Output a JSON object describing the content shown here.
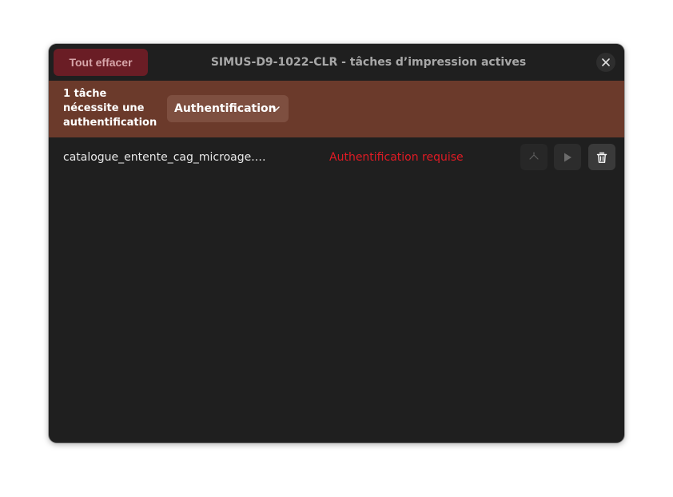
{
  "window": {
    "title": "SIMUS-D9-1022-CLR - tâches d’impression actives",
    "clear_all_label": "Tout effacer"
  },
  "banner": {
    "line1": "1 tâche",
    "line2": "nécessite une",
    "line3": "authentification",
    "auth_button_label": "Authentification"
  },
  "jobs": [
    {
      "name": "catalogue_entente_cag_microage.…",
      "status": "Authentification requise"
    }
  ],
  "colors": {
    "window_bg": "#1f1f1f",
    "banner_bg": "#6b3a2b",
    "destructive": "#6a1d25",
    "status_error": "#e01b24"
  },
  "icons": {
    "close": "close-icon",
    "chevron": "chevron-down-icon",
    "priority": "priority-up-icon",
    "resume": "play-icon",
    "delete": "trash-icon"
  }
}
